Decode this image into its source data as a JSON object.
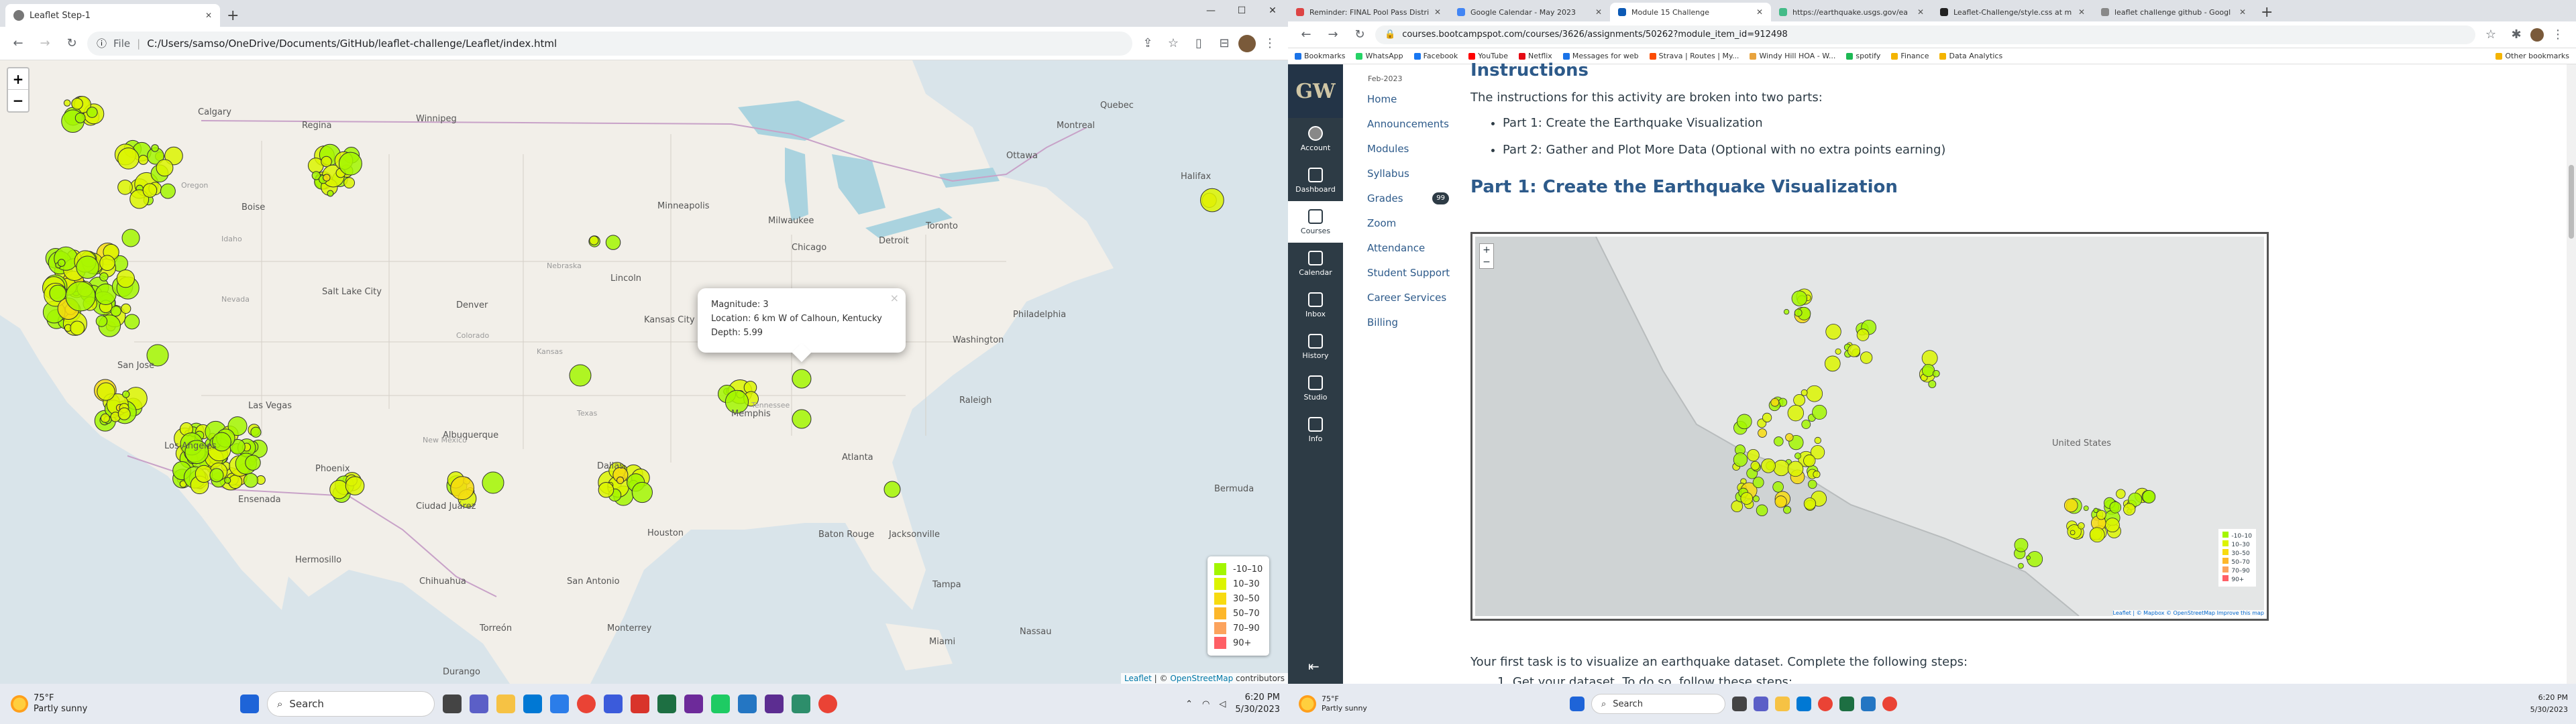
{
  "left": {
    "tab": {
      "title": "Leaflet Step-1"
    },
    "address": {
      "label": "File",
      "url": "C:/Users/samso/OneDrive/Documents/GitHub/leaflet-challenge/Leaflet/index.html"
    },
    "map": {
      "zoom_in": "+",
      "zoom_out": "−",
      "cities": [
        "Calgary",
        "Regina",
        "Winnipeg",
        "Ottawa",
        "Montreal",
        "Quebec",
        "Boise",
        "Minneapolis",
        "Milwaukee",
        "Toronto",
        "Detroit",
        "Halifax",
        "Salt Lake City",
        "Lincoln",
        "Chicago",
        "Denver",
        "Kansas City",
        "Philadelphia",
        "Washington",
        "San Jose",
        "Las Vegas",
        "Albuquerque",
        "Memphis",
        "Raleigh",
        "Los Angeles",
        "Phoenix",
        "Dallas",
        "Atlanta",
        "Ensenada",
        "Ciudad Juárez",
        "Houston",
        "Baton Rouge",
        "Jacksonville",
        "Hermosillo",
        "Chihuahua",
        "San Antonio",
        "Torreón",
        "Monterrey",
        "Durango",
        "Tampa",
        "Miami",
        "Nassau",
        "Bermuda",
        "New Mexico",
        "Kansas",
        "Tennessee",
        "Ohio",
        "Texas",
        "Colorado",
        "Nevada",
        "Oregon",
        "Idaho",
        "Nebraska",
        "Illinois"
      ],
      "popup": {
        "magnitude": "Magnitude: 3",
        "location": "Location: 6 km W of Calhoun, Kentucky",
        "depth": "Depth: 5.99",
        "close": "×"
      },
      "legend": [
        {
          "label": "-10–10",
          "color": "#a3f600"
        },
        {
          "label": "10–30",
          "color": "#dcf400"
        },
        {
          "label": "30–50",
          "color": "#f7db11"
        },
        {
          "label": "50–70",
          "color": "#fdb72a"
        },
        {
          "label": "70–90",
          "color": "#fca35d"
        },
        {
          "label": "90+",
          "color": "#ff5f65"
        }
      ],
      "attribution_leaflet": "Leaflet",
      "attribution_sep": " | © ",
      "attribution_osm": "OpenStreetMap",
      "attribution_tail": " contributors"
    },
    "taskbar": {
      "temp": "75°F",
      "weather": "Partly sunny",
      "search": "Search",
      "time": "6:20 PM",
      "date": "5/30/2023"
    }
  },
  "right": {
    "tabs": [
      "Reminder: FINAL Pool Pass Distri",
      "Google Calendar - May 2023",
      "Module 15 Challenge",
      "https://earthquake.usgs.gov/ea",
      "Leaflet-Challenge/style.css at m",
      "leaflet challenge github - Googl"
    ],
    "address": "courses.bootcampspot.com/courses/3626/assignments/50262?module_item_id=912498",
    "bookmarks": [
      "Bookmarks",
      "WhatsApp",
      "Facebook",
      "YouTube",
      "Netflix",
      "Messages for web",
      "Strava | Routes | My...",
      "Windy Hill HOA - W...",
      "spotify",
      "Finance",
      "Data Analytics",
      "Other bookmarks"
    ],
    "nav": [
      "Account",
      "Dashboard",
      "Courses",
      "Calendar",
      "Inbox",
      "History",
      "Studio",
      "Info"
    ],
    "course": {
      "term": "Feb-2023",
      "links": [
        "Home",
        "Announcements",
        "Modules",
        "Syllabus",
        "Grades",
        "Zoom",
        "Attendance",
        "Student Support",
        "Career Services",
        "Billing"
      ],
      "grades_badge": "99"
    },
    "content": {
      "heading": "Instructions",
      "intro": "The instructions for this activity are broken into two parts:",
      "parts": [
        "Part 1: Create the Earthquake Visualization",
        "Part 2: Gather and Plot More Data (Optional with no extra points earning)"
      ],
      "part1_heading": "Part 1: Create the Earthquake Visualization",
      "first_task": "Your first task is to visualize an earthquake dataset. Complete the following steps:",
      "step1": "1. Get your dataset. To do so, follow these steps:",
      "mini_legend": [
        "-10–10",
        "10–30",
        "30–50",
        "50–70",
        "70–90",
        "90+"
      ],
      "mini_attrib": "Leaflet | © Mapbox © OpenStreetMap Improve this map",
      "mini_country": "United States"
    },
    "taskbar": {
      "temp": "75°F",
      "weather": "Partly sunny",
      "search": "Search",
      "time": "6:20 PM",
      "date": "5/30/2023"
    }
  }
}
